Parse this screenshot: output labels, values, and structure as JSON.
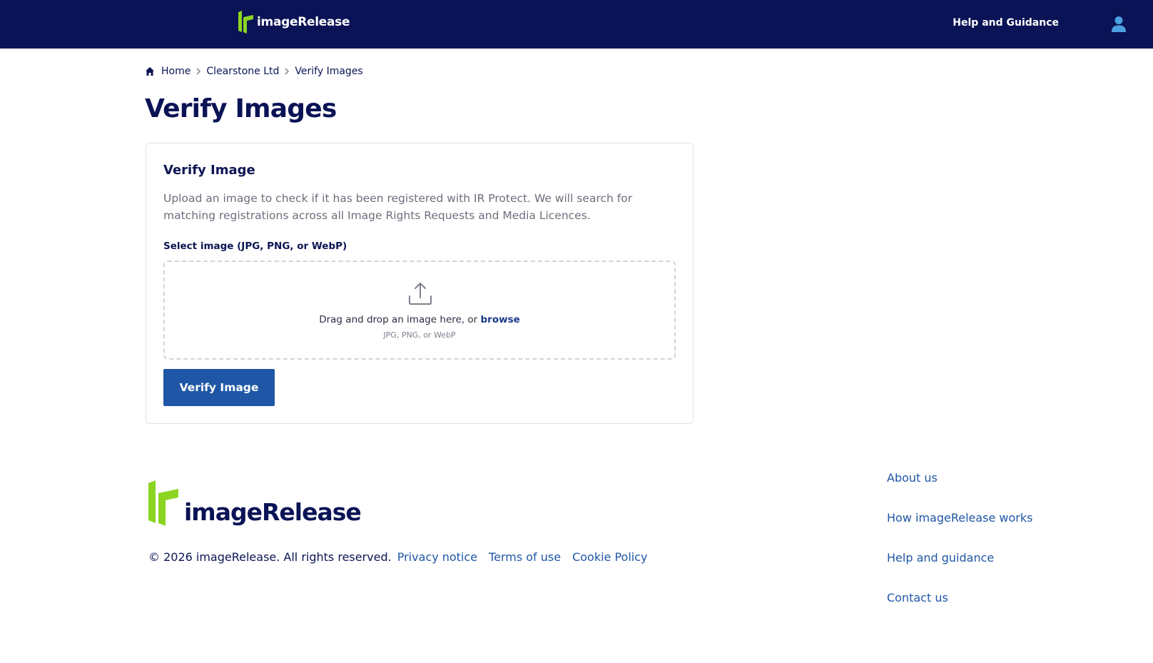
{
  "header": {
    "brand": "imageRelease",
    "help_link": "Help and Guidance",
    "user_icon": "user-icon"
  },
  "breadcrumb": {
    "home": "Home",
    "org": "Clearstone Ltd",
    "current": "Verify Images"
  },
  "page": {
    "title": "Verify Images"
  },
  "card": {
    "title": "Verify Image",
    "description": "Upload an image to check if it has been registered with IR Protect. We will search for matching registrations across all Image Rights Requests and Media Licences.",
    "field_label": "Select image (JPG, PNG, or WebP)",
    "dropzone": {
      "text": "Drag and drop an image here, or ",
      "browse": "browse",
      "hint": "JPG, PNG, or WebP"
    },
    "button": "Verify Image"
  },
  "footer": {
    "brand": "imageRelease",
    "copyright": "© 2026 imageRelease. All rights reserved.",
    "links": {
      "privacy": "Privacy notice",
      "terms": "Terms of use",
      "cookie": "Cookie Policy"
    },
    "nav": {
      "about": "About us",
      "how": "How imageRelease works",
      "help": "Help and guidance",
      "contact": "Contact us"
    }
  },
  "colors": {
    "navy": "#0a1355",
    "brand_green": "#8cd422",
    "link_blue": "#1f57a6",
    "user_icon_blue": "#4aa0e0"
  }
}
